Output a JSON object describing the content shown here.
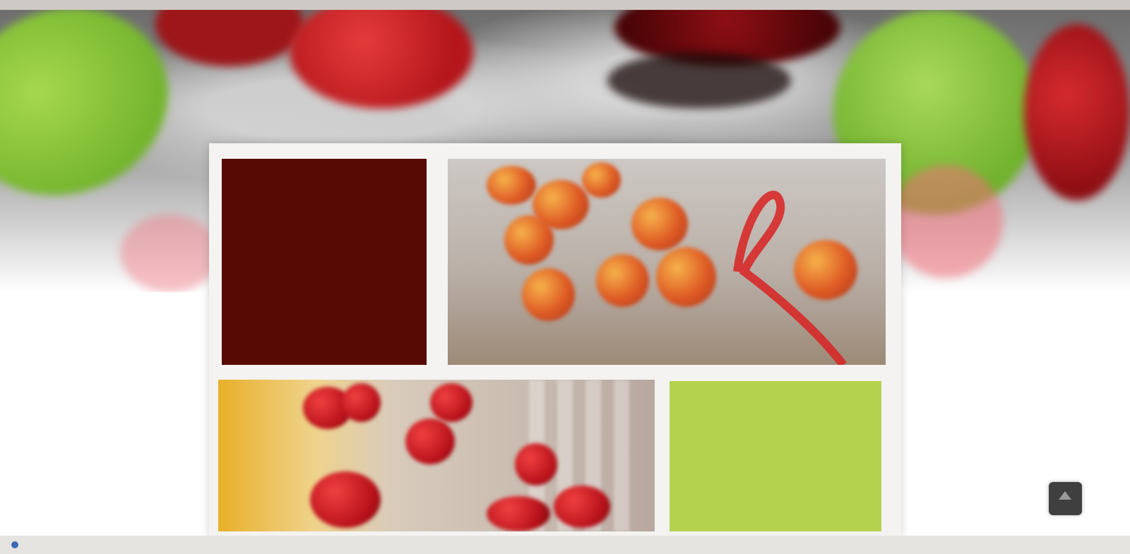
{
  "hero": {
    "image": "strawberries-banner"
  },
  "gallery": {
    "text_tile": {
      "paragraph_1": "",
      "paragraph_2": ""
    },
    "photo_1": {
      "image": "physalis-berries-red-ribbon"
    },
    "photo_2": {
      "image": "strawberries-and-yellow-fruit"
    },
    "promo_tile": {
      "line": "",
      "link": ""
    }
  },
  "scroll_top": {
    "icon": "arrow-up-icon"
  },
  "colors": {
    "text_tile_bg": "#560a03",
    "promo_tile_bg": "#b5d24f",
    "promo_link": "#e8951e",
    "scroll_button_bg": "#3f3f3f"
  }
}
